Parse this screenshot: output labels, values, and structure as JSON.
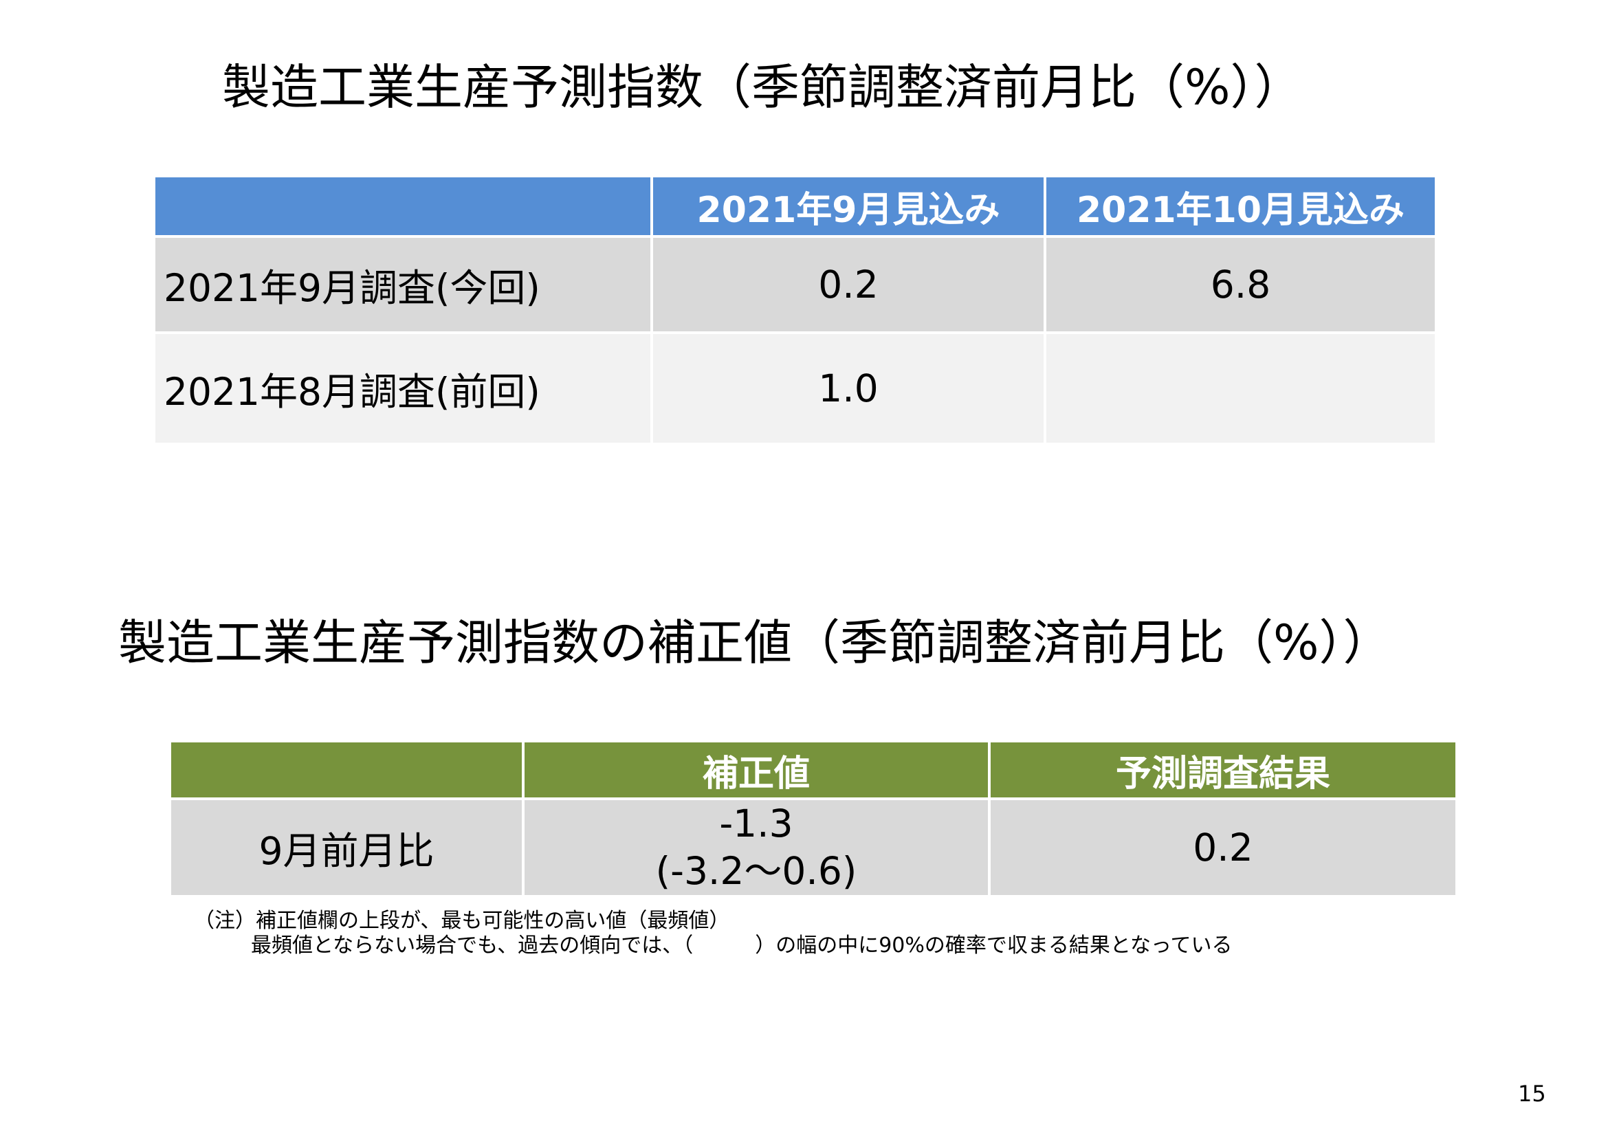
{
  "slide": {
    "title1": "製造工業生産予測指数（季節調整済前月比（%））",
    "title2": "製造工業生産予測指数の補正値（季節調整済前月比（%））",
    "page_number": "15"
  },
  "table1": {
    "header_color": "#558ed5",
    "columns": [
      "",
      "2021年9月見込み",
      "2021年10月見込み"
    ],
    "rows": [
      {
        "label": "2021年9月調査(今回)",
        "values": [
          "0.2",
          "6.8"
        ]
      },
      {
        "label": "2021年8月調査(前回)",
        "values": [
          "1.0",
          ""
        ]
      }
    ]
  },
  "table2": {
    "header_color": "#77933c",
    "columns": [
      "",
      "補正値",
      "予測調査結果"
    ],
    "rows": [
      {
        "label": "9月前月比",
        "correction_value": "-1.3",
        "correction_range": "(-3.2～0.6)",
        "survey_result": "0.2"
      }
    ]
  },
  "notes": {
    "line1": "（注）補正値欄の上段が、最も可能性の高い値（最頻値）",
    "line2": "最頻値とならない場合でも、過去の傾向では、（　　　）の幅の中に90%の確率で収まる結果となっている"
  }
}
